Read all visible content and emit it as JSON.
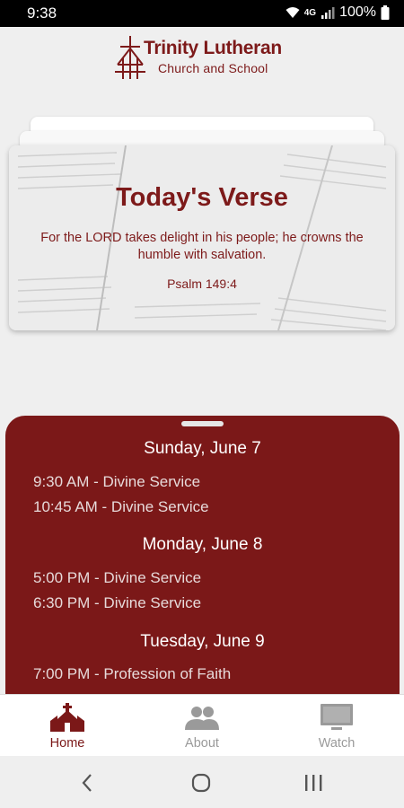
{
  "status_bar": {
    "time": "9:38",
    "network": "4G",
    "battery": "100%"
  },
  "header": {
    "logo_title": "Trinity Lutheran",
    "logo_subtitle": "Church and School"
  },
  "verse": {
    "title": "Today's Verse",
    "text": "For the LORD takes delight in his people; he crowns the humble with salvation.",
    "reference": "Psalm 149:4"
  },
  "schedule": {
    "days": [
      {
        "heading": "Sunday, June 7",
        "services": [
          "9:30 AM - Divine Service",
          "10:45 AM - Divine Service"
        ]
      },
      {
        "heading": "Monday, June 8",
        "services": [
          "5:00 PM - Divine Service",
          "6:30 PM - Divine Service"
        ]
      },
      {
        "heading": "Tuesday, June 9",
        "services": [
          "7:00 PM - Profession of Faith"
        ]
      }
    ]
  },
  "bottom_nav": {
    "items": [
      {
        "label": "Home",
        "icon": "church-icon",
        "active": true
      },
      {
        "label": "About",
        "icon": "people-icon",
        "active": false
      },
      {
        "label": "Watch",
        "icon": "tv-icon",
        "active": false
      }
    ]
  },
  "system_nav": {
    "back": "back-icon",
    "home": "home-circle-icon",
    "recents": "recents-icon"
  },
  "colors": {
    "brand": "#7b1818",
    "inactive": "#9a9a9a",
    "background": "#efefef"
  }
}
